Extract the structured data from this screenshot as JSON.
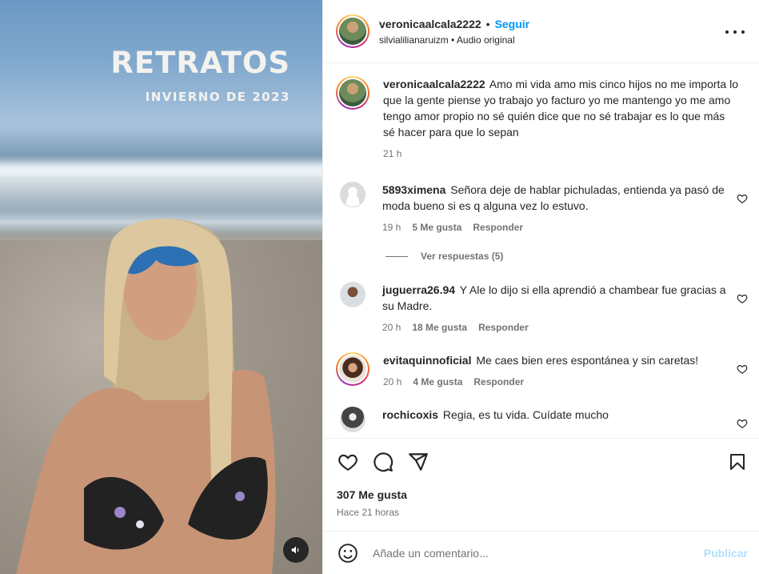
{
  "media": {
    "overlay_title": "RETRATOS",
    "overlay_subtitle": "INVIERNO DE 2023"
  },
  "header": {
    "username": "veronicaalcala2222",
    "separator": "•",
    "follow_label": "Seguir",
    "audio_user": "silvialilianaruizm",
    "audio_separator": "•",
    "audio_label": "Audio original"
  },
  "caption": {
    "username": "veronicaalcala2222",
    "text": "Amo mi vida amo mis cinco hijos no me importa lo que la gente piense yo trabajo yo facturo yo me mantengo yo me amo tengo amor propio no sé quién dice que no sé trabajar es lo que más sé hacer para que lo sepan",
    "time": "21 h"
  },
  "comments": [
    {
      "username": "5893ximena",
      "text": "Señora deje de hablar pichuladas, entienda ya pasó de moda bueno si es q alguna vez lo estuvo.",
      "time": "19 h",
      "likes": "5 Me gusta",
      "reply": "Responder",
      "view_replies": "Ver respuestas (5)"
    },
    {
      "username": "juguerra26.94",
      "text": "Y Ale lo dijo si ella aprendió a chambear fue gracias a su Madre.",
      "time": "20 h",
      "likes": "18 Me gusta",
      "reply": "Responder"
    },
    {
      "username": "evitaquinnoficial",
      "text": "Me caes bien eres espontánea y sin caretas!",
      "time": "20 h",
      "likes": "4 Me gusta",
      "reply": "Responder"
    },
    {
      "username": "rochicoxis",
      "text": "Regia, es tu vida. Cuídate mucho"
    }
  ],
  "footer": {
    "likes": "307 Me gusta",
    "posted": "Hace 21 horas",
    "comment_placeholder": "Añade un comentario...",
    "publish_label": "Publicar"
  },
  "colors": {
    "accent": "#0095f6",
    "publish_disabled": "#b2dffc",
    "secondary_text": "#737373"
  }
}
